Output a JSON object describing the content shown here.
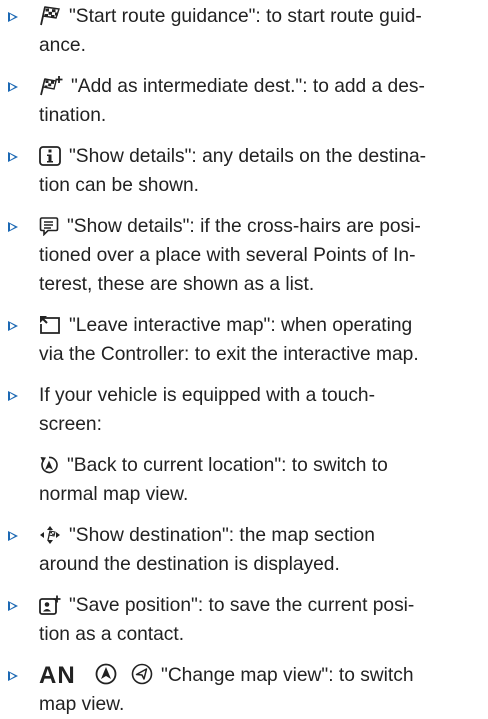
{
  "items": [
    {
      "line1": "\"Start route guidance\": to start route guid-",
      "line2": "ance."
    },
    {
      "line1": "\"Add as intermediate dest.\": to add a des-",
      "line2": "tination."
    },
    {
      "line1": "\"Show details\": any details on the destina-",
      "line2": "tion can be shown."
    },
    {
      "line1": "\"Show details\": if the cross-hairs are posi-",
      "line2": "tioned over a place with several Points of In-",
      "line3": "terest, these are shown as a list."
    },
    {
      "line1": "\"Leave interactive map\": when operating",
      "line2": "via the Controller: to exit the interactive map."
    },
    {
      "line1": "If your vehicle is equipped with a touch-",
      "line2": "screen:",
      "sub1": "\"Back to current location\": to switch to",
      "sub2": "normal map view."
    },
    {
      "line1": "\"Show destination\": the map section",
      "line2": "around the destination is displayed."
    },
    {
      "line1": "\"Save position\": to save the current posi-",
      "line2": "tion as a contact."
    },
    {
      "an_label": "AN",
      "line1": "\"Change map view\": to switch",
      "line2": "map view."
    }
  ],
  "colors": {
    "bullet": "#1c69b4",
    "text": "#222222"
  },
  "icons": [
    "checkered-flag-icon",
    "flag-plus-icon",
    "info-icon",
    "poi-list-icon",
    "leave-map-icon",
    "back-to-location-icon",
    "show-destination-icon",
    "save-position-icon",
    "map-view-icons"
  ]
}
